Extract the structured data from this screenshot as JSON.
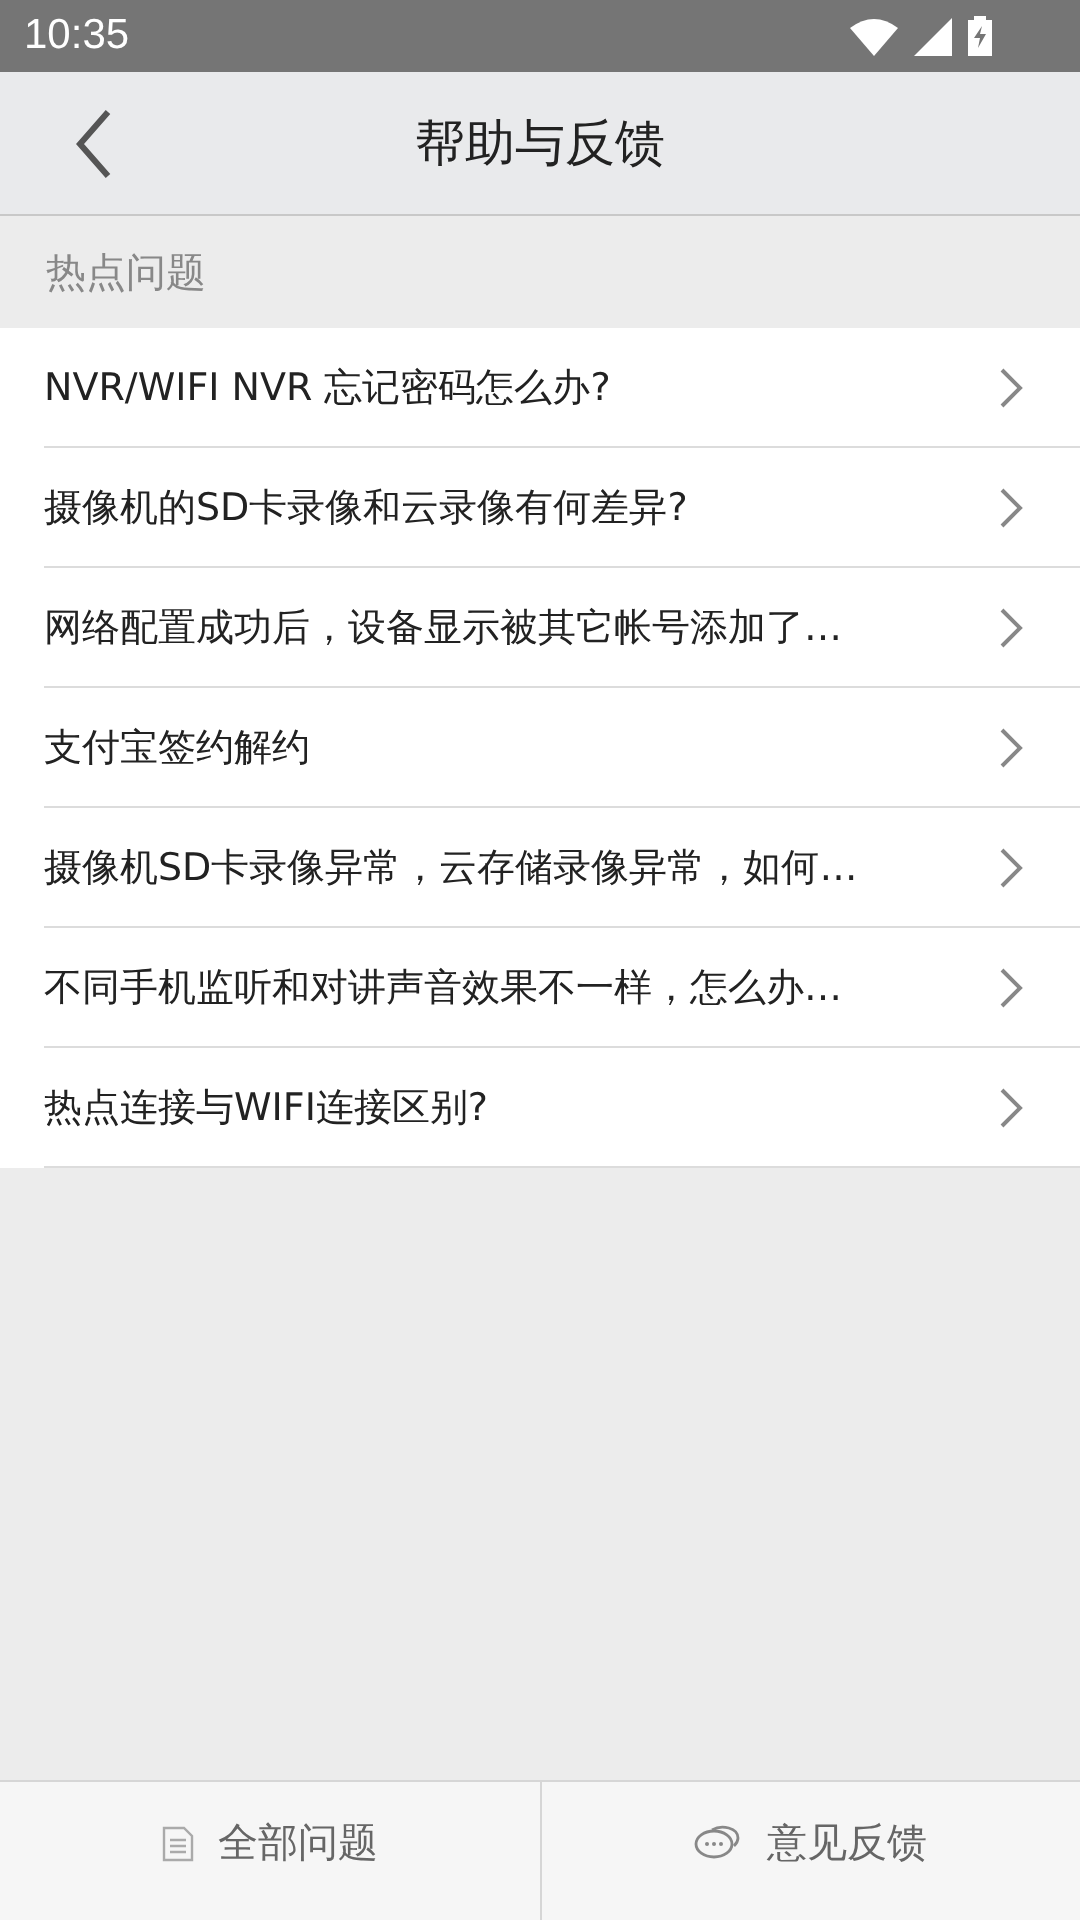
{
  "status_bar": {
    "time": "10:35"
  },
  "header": {
    "title": "帮助与反馈"
  },
  "section": {
    "title": "热点问题"
  },
  "questions": [
    {
      "text": "NVR/WIFI NVR 忘记密码怎么办?"
    },
    {
      "text": "摄像机的SD卡录像和云录像有何差异?"
    },
    {
      "text": "网络配置成功后，设备显示被其它帐号添加了…"
    },
    {
      "text": "支付宝签约解约"
    },
    {
      "text": "摄像机SD卡录像异常，云存储录像异常，如何…"
    },
    {
      "text": "不同手机监听和对讲声音效果不一样，怎么办…"
    },
    {
      "text": "热点连接与WIFI连接区别?"
    }
  ],
  "bottom_tabs": [
    {
      "label": "全部问题",
      "kind": "document"
    },
    {
      "label": "意见反馈",
      "kind": "chat"
    }
  ]
}
